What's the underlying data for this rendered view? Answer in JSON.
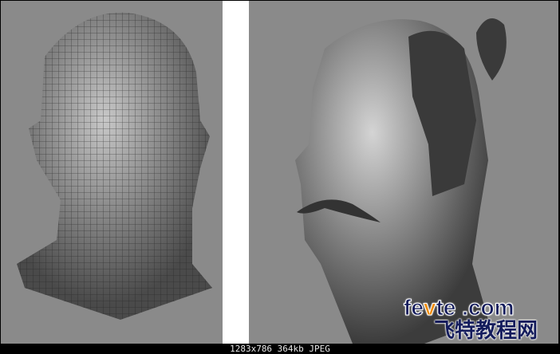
{
  "caption": "1283x786 364kb JPEG",
  "watermark": {
    "brand_pre": "fe",
    "brand_v": "v",
    "brand_post": "te .com",
    "chinese": "飞特教程网"
  },
  "colors": {
    "background": "#8a8a8a",
    "watermark_blue": "#141c5c",
    "watermark_orange": "#f08a00"
  }
}
